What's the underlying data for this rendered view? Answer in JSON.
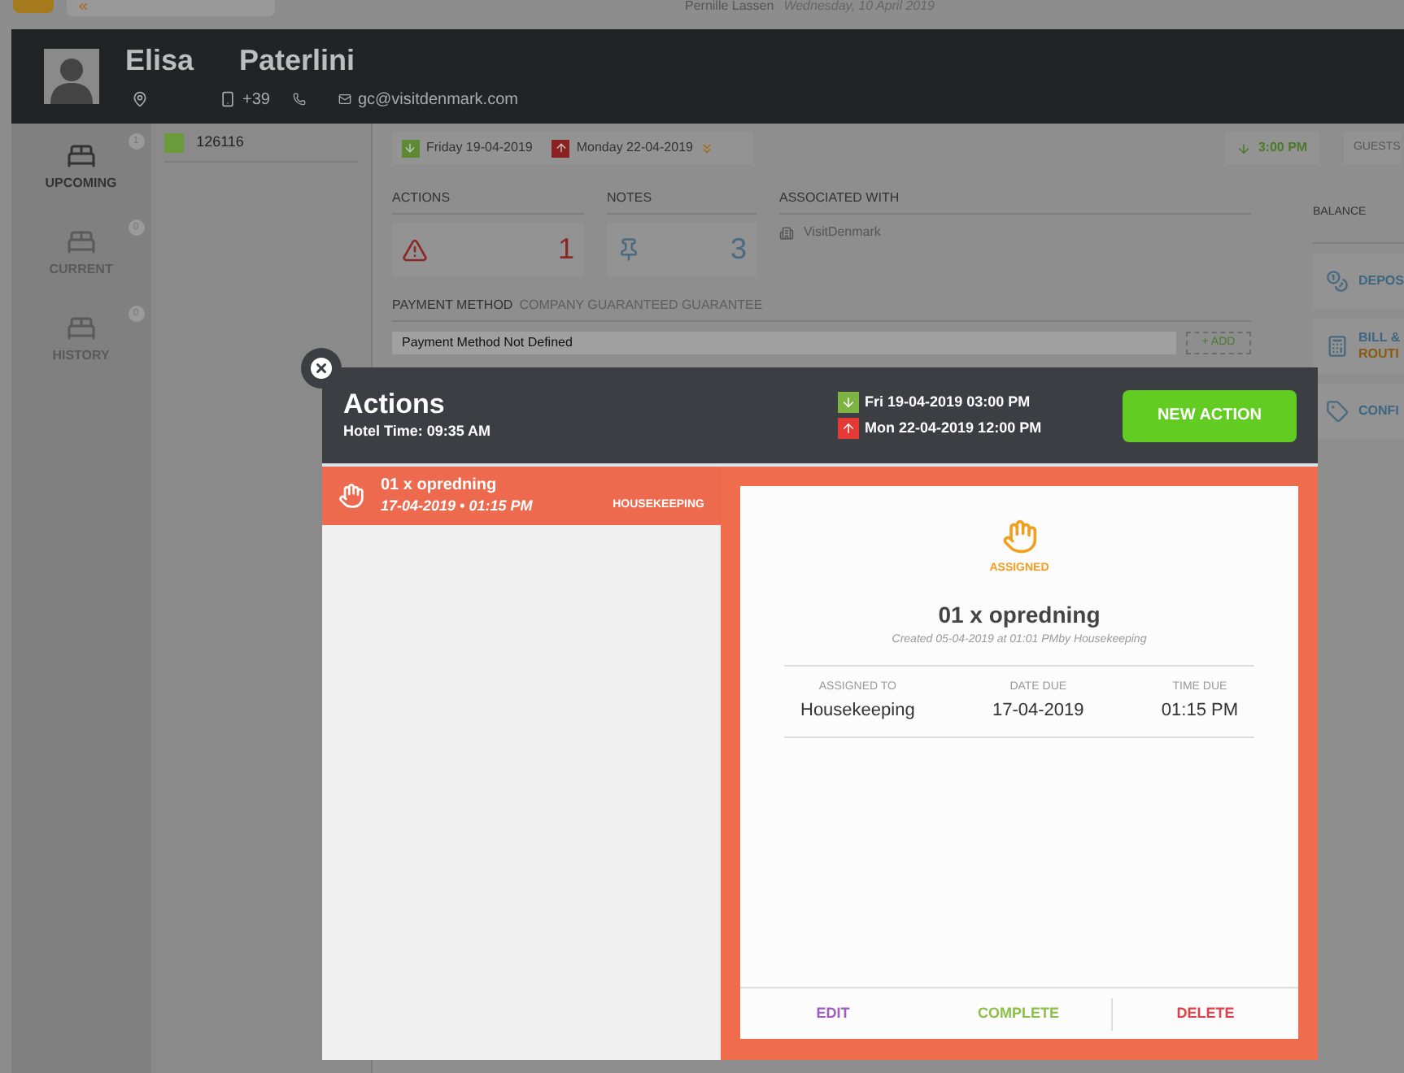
{
  "top_bar": {
    "user": "Pernille Lassen",
    "date": "Wednesday, 10 April 2019"
  },
  "guest": {
    "first_name": "Elisa",
    "last_name": "Paterlini",
    "phone": "+39",
    "email": "gc@visitdenmark.com"
  },
  "nav": [
    {
      "label": "UPCOMING",
      "count": "1",
      "selected": true
    },
    {
      "label": "CURRENT",
      "count": "0",
      "selected": false
    },
    {
      "label": "HISTORY",
      "count": "0",
      "selected": false
    }
  ],
  "reservations": [
    {
      "number": "126116",
      "color": "#6a9a3a",
      "selected": true
    }
  ],
  "stay": {
    "arrival": "Friday 19-04-2019",
    "departure": "Monday 22-04-2019",
    "time": "3:00 PM",
    "guests_label": "GUESTS"
  },
  "actions": {
    "title": "ACTIONS",
    "count": "1"
  },
  "notes": {
    "title": "NOTES",
    "count": "3"
  },
  "associated": {
    "title": "ASSOCIATED WITH",
    "name": "VisitDenmark"
  },
  "payment": {
    "title": "PAYMENT METHOD",
    "guarantee": "COMPANY GUARANTEED GUARANTEE",
    "value": "Payment Method Not Defined",
    "add_label": "+ ADD"
  },
  "balance": {
    "title": "BALANCE",
    "items": [
      {
        "kind": "deposit",
        "lines": [
          "DEPOS"
        ]
      },
      {
        "kind": "bill",
        "lines": [
          "BILL &",
          "ROUTI"
        ]
      },
      {
        "kind": "confirm",
        "lines": [
          "CONFI"
        ]
      }
    ]
  },
  "modal": {
    "title": "Actions",
    "hotel_time": "Hotel Time: 09:35 AM",
    "arrival": "Fri 19-04-2019 03:00 PM",
    "departure": "Mon 22-04-2019 12:00 PM",
    "new_action": "NEW ACTION",
    "items": [
      {
        "title": "01 x opredning",
        "when": "17-04-2019 • 01:15 PM",
        "department": "HOUSEKEEPING",
        "selected": true
      }
    ],
    "detail": {
      "status": "ASSIGNED",
      "title": "01 x opredning",
      "created": "Created 05-04-2019 at 01:01 PMby Housekeeping",
      "fields": [
        {
          "label": "ASSIGNED TO",
          "value": "Housekeeping"
        },
        {
          "label": "DATE DUE",
          "value": "17-04-2019"
        },
        {
          "label": "TIME DUE",
          "value": "01:15 PM"
        }
      ],
      "buttons": [
        {
          "kind": "edit",
          "label": "EDIT"
        },
        {
          "kind": "complete",
          "label": "COMPLETE"
        },
        {
          "kind": "delete",
          "label": "DELETE"
        }
      ]
    }
  }
}
